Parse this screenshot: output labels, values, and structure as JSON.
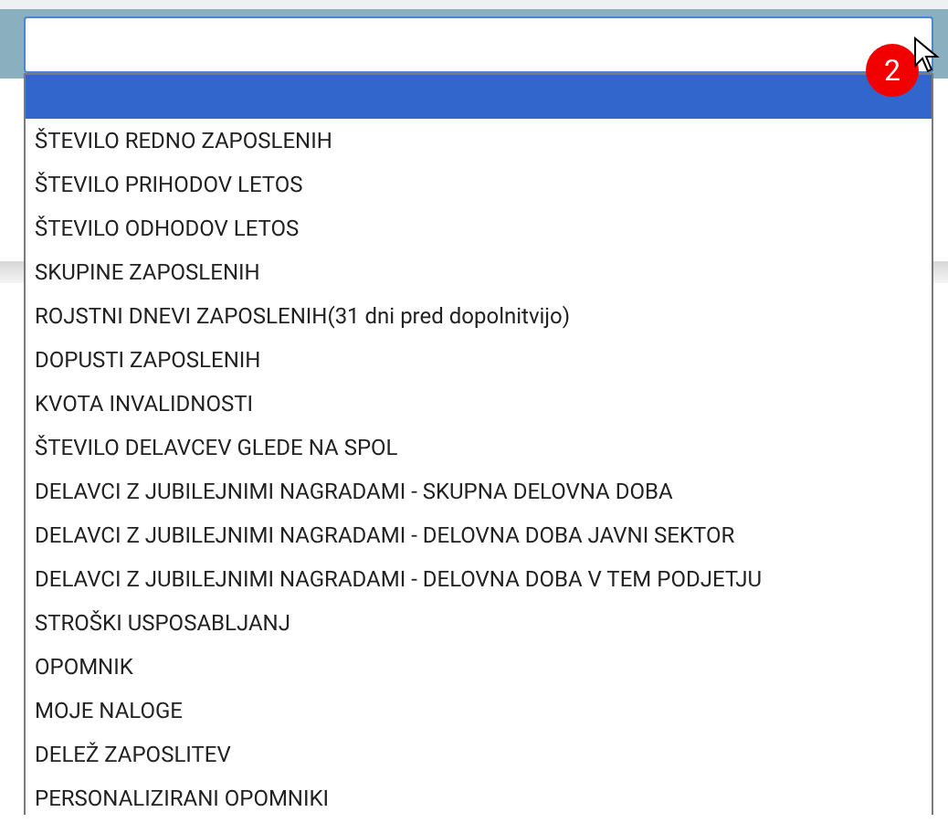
{
  "select": {
    "badge": "2",
    "options": [
      {
        "selected": true
      },
      {
        "label": "ŠTEVILO REDNO ZAPOSLENIH",
        "selected": false
      },
      {
        "label": "ŠTEVILO PRIHODOV LETOS",
        "selected": false
      },
      {
        "label": "ŠTEVILO ODHODOV LETOS",
        "selected": false
      },
      {
        "label": "SKUPINE ZAPOSLENIH",
        "selected": false
      },
      {
        "label": "ROJSTNI DNEVI ZAPOSLENIH(31 dni pred dopolnitvijo)",
        "selected": false
      },
      {
        "label": "DOPUSTI ZAPOSLENIH",
        "selected": false
      },
      {
        "label": "KVOTA INVALIDNOSTI",
        "selected": false
      },
      {
        "label": "ŠTEVILO DELAVCEV GLEDE NA SPOL",
        "selected": false
      },
      {
        "label": "DELAVCI Z JUBILEJNIMI NAGRADAMI - SKUPNA DELOVNA DOBA",
        "selected": false
      },
      {
        "label": "DELAVCI Z JUBILEJNIMI NAGRADAMI - DELOVNA DOBA JAVNI SEKTOR",
        "selected": false
      },
      {
        "label": "DELAVCI Z JUBILEJNIMI NAGRADAMI - DELOVNA DOBA V TEM PODJETJU",
        "selected": false
      },
      {
        "label": "STROŠKI USPOSABLJANJ",
        "selected": false
      },
      {
        "label": "OPOMNIK",
        "selected": false
      },
      {
        "label": "MOJE NALOGE",
        "selected": false
      },
      {
        "label": "DELEŽ ZAPOSLITEV",
        "selected": false
      },
      {
        "label": "PERSONALIZIRANI OPOMNIKI",
        "selected": false
      }
    ]
  }
}
